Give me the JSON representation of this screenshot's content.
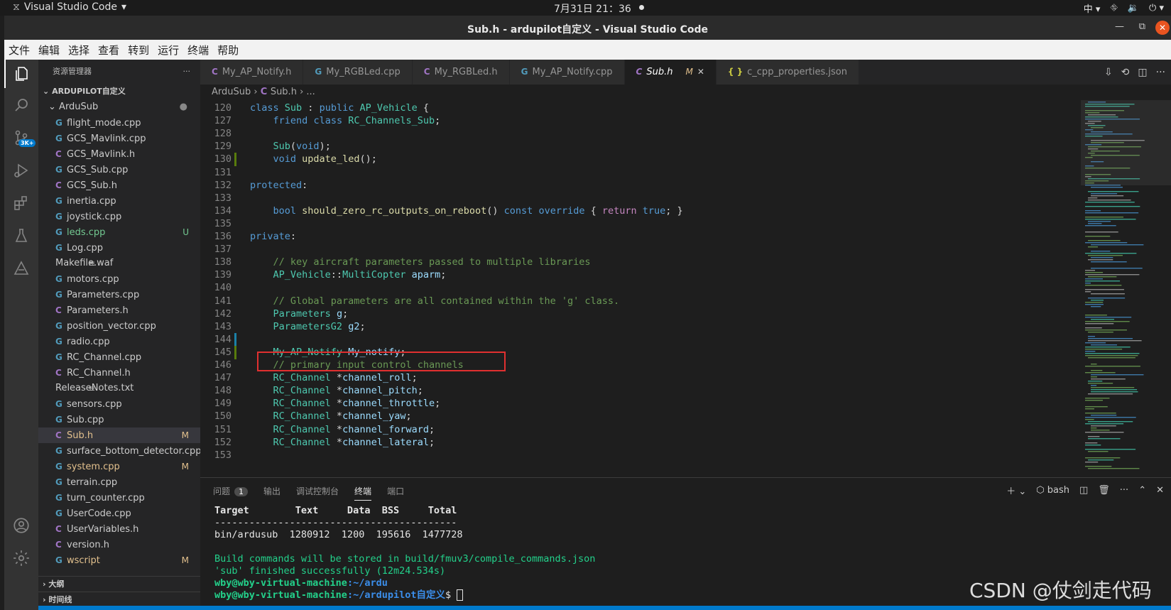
{
  "topbar": {
    "app_name": "Visual Studio Code",
    "clock": "7月31日  21：36",
    "input_method": "中"
  },
  "window": {
    "title": "Sub.h - ardupilot自定义 - Visual Studio Code"
  },
  "menu": [
    "文件",
    "编辑",
    "选择",
    "查看",
    "转到",
    "运行",
    "终端",
    "帮助"
  ],
  "activity_bar": {
    "scm_badge": "3K+"
  },
  "sidebar": {
    "header": "资源管理器",
    "workspace": "ARDUPILOT自定义",
    "folder": "ArduSub",
    "files": [
      {
        "name": "flight_mode.cpp",
        "type": "cpp",
        "status": ""
      },
      {
        "name": "GCS_Mavlink.cpp",
        "type": "cpp",
        "status": ""
      },
      {
        "name": "GCS_Mavlink.h",
        "type": "h",
        "status": ""
      },
      {
        "name": "GCS_Sub.cpp",
        "type": "cpp",
        "status": ""
      },
      {
        "name": "GCS_Sub.h",
        "type": "h",
        "status": ""
      },
      {
        "name": "inertia.cpp",
        "type": "cpp",
        "status": ""
      },
      {
        "name": "joystick.cpp",
        "type": "cpp",
        "status": ""
      },
      {
        "name": "leds.cpp",
        "type": "cpp",
        "status": "U"
      },
      {
        "name": "Log.cpp",
        "type": "cpp",
        "status": ""
      },
      {
        "name": "Makefile.waf",
        "type": "txt",
        "status": ""
      },
      {
        "name": "motors.cpp",
        "type": "cpp",
        "status": ""
      },
      {
        "name": "Parameters.cpp",
        "type": "cpp",
        "status": ""
      },
      {
        "name": "Parameters.h",
        "type": "h",
        "status": ""
      },
      {
        "name": "position_vector.cpp",
        "type": "cpp",
        "status": ""
      },
      {
        "name": "radio.cpp",
        "type": "cpp",
        "status": ""
      },
      {
        "name": "RC_Channel.cpp",
        "type": "cpp",
        "status": ""
      },
      {
        "name": "RC_Channel.h",
        "type": "h",
        "status": ""
      },
      {
        "name": "ReleaseNotes.txt",
        "type": "txt",
        "status": ""
      },
      {
        "name": "sensors.cpp",
        "type": "cpp",
        "status": ""
      },
      {
        "name": "Sub.cpp",
        "type": "cpp",
        "status": ""
      },
      {
        "name": "Sub.h",
        "type": "h",
        "status": "M"
      },
      {
        "name": "surface_bottom_detector.cpp",
        "type": "cpp",
        "status": ""
      },
      {
        "name": "system.cpp",
        "type": "cpp",
        "status": "M"
      },
      {
        "name": "terrain.cpp",
        "type": "cpp",
        "status": ""
      },
      {
        "name": "turn_counter.cpp",
        "type": "cpp",
        "status": ""
      },
      {
        "name": "UserCode.cpp",
        "type": "cpp",
        "status": ""
      },
      {
        "name": "UserVariables.h",
        "type": "h",
        "status": ""
      },
      {
        "name": "version.h",
        "type": "h",
        "status": ""
      },
      {
        "name": "wscript",
        "type": "cpp",
        "status": "M"
      }
    ],
    "outline": "大纲",
    "timeline": "时间线"
  },
  "tabs": [
    {
      "label": "My_AP_Notify.h",
      "type": "h"
    },
    {
      "label": "My_RGBLed.cpp",
      "type": "cpp"
    },
    {
      "label": "My_RGBLed.h",
      "type": "h"
    },
    {
      "label": "My_AP_Notify.cpp",
      "type": "cpp"
    },
    {
      "label": "Sub.h",
      "type": "h",
      "active": true,
      "status": "M"
    },
    {
      "label": "c_cpp_properties.json",
      "type": "json"
    }
  ],
  "breadcrumb": [
    "ArduSub",
    "Sub.h",
    "..."
  ],
  "editor": {
    "lines": [
      {
        "n": "120",
        "t": "class Sub : public AP_Vehicle {"
      },
      {
        "n": "127",
        "t": "    friend class RC_Channels_Sub;"
      },
      {
        "n": "128",
        "t": ""
      },
      {
        "n": "129",
        "t": "    Sub(void);"
      },
      {
        "n": "130",
        "t": "    void update_led();"
      },
      {
        "n": "131",
        "t": ""
      },
      {
        "n": "132",
        "t": "protected:"
      },
      {
        "n": "133",
        "t": ""
      },
      {
        "n": "134",
        "t": "    bool should_zero_rc_outputs_on_reboot() const override { return true; }"
      },
      {
        "n": "135",
        "t": ""
      },
      {
        "n": "136",
        "t": "private:"
      },
      {
        "n": "137",
        "t": ""
      },
      {
        "n": "138",
        "t": "    // key aircraft parameters passed to multiple libraries"
      },
      {
        "n": "139",
        "t": "    AP_Vehicle::MultiCopter aparm;"
      },
      {
        "n": "140",
        "t": ""
      },
      {
        "n": "141",
        "t": "    // Global parameters are all contained within the 'g' class."
      },
      {
        "n": "142",
        "t": "    Parameters g;"
      },
      {
        "n": "143",
        "t": "    ParametersG2 g2;"
      },
      {
        "n": "144",
        "t": ""
      },
      {
        "n": "145",
        "t": "    My_AP_Notify My_notify;"
      },
      {
        "n": "146",
        "t": "    // primary input control channels"
      },
      {
        "n": "147",
        "t": "    RC_Channel *channel_roll;"
      },
      {
        "n": "148",
        "t": "    RC_Channel *channel_pitch;"
      },
      {
        "n": "149",
        "t": "    RC_Channel *channel_throttle;"
      },
      {
        "n": "150",
        "t": "    RC_Channel *channel_yaw;"
      },
      {
        "n": "151",
        "t": "    RC_Channel *channel_forward;"
      },
      {
        "n": "152",
        "t": "    RC_Channel *channel_lateral;"
      },
      {
        "n": "153",
        "t": ""
      }
    ]
  },
  "panel": {
    "tabs": [
      "问题",
      "输出",
      "调试控制台",
      "终端",
      "端口"
    ],
    "problems_count": "1",
    "shell": "bash",
    "terminal": {
      "header": "Target        Text     Data  BSS     Total",
      "divider": "------------------------------------------",
      "row": "bin/ardusub  1280912  1200  195616  1477728",
      "build1": "Build commands will be stored in build/fmuv3/compile_commands.json",
      "build2": "'sub' finished successfully (12m24.534s)",
      "prompt1_user": "wby@wby-virtual-machine",
      "prompt1_path": ":~/ardu",
      "prompt2_user": "wby@wby-virtual-machine",
      "prompt2_path": ":~/ardupilot自定义",
      "prompt2_sym": "$ "
    }
  },
  "watermark": "CSDN @仗剑走代码"
}
